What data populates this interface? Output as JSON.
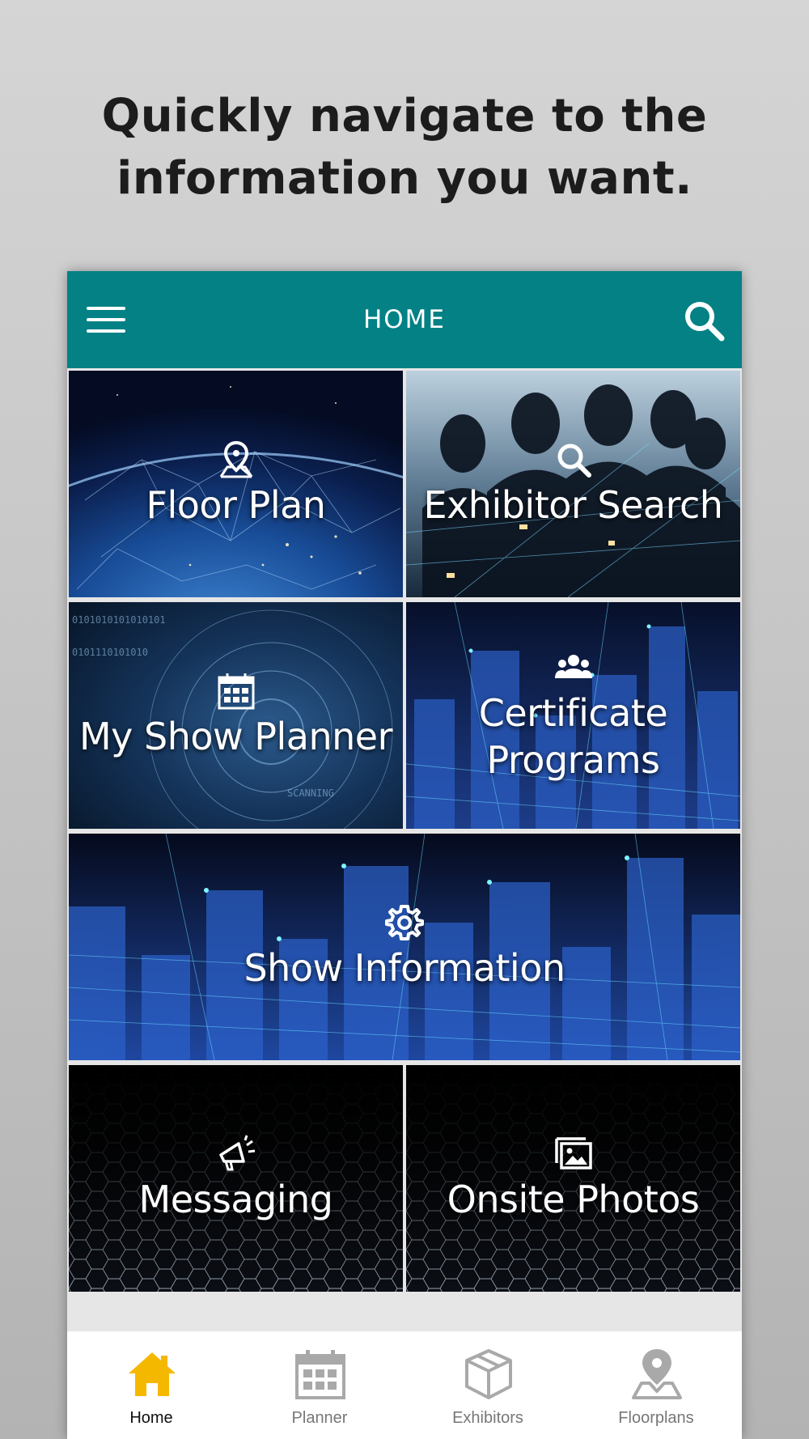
{
  "headline": {
    "line1": "Quickly navigate to the",
    "line2": "information you want."
  },
  "app_bar": {
    "title": "HOME",
    "menu_icon": "hamburger-menu-icon",
    "search_icon": "search-icon",
    "color": "#038185"
  },
  "tiles": [
    {
      "label": "Floor Plan",
      "icon": "map-pin-icon"
    },
    {
      "label": "Exhibitor Search",
      "icon": "search-icon"
    },
    {
      "label": "My Show Planner",
      "icon": "calendar-icon"
    },
    {
      "label_line1": "Certificate",
      "label_line2": "Programs",
      "icon": "group-icon"
    },
    {
      "label": "Show Information",
      "icon": "gear-icon"
    },
    {
      "label": "Messaging",
      "icon": "megaphone-icon"
    },
    {
      "label": "Onsite Photos",
      "icon": "photos-icon"
    }
  ],
  "tab_bar": {
    "items": [
      {
        "label": "Home",
        "icon": "home-icon",
        "active": true
      },
      {
        "label": "Planner",
        "icon": "calendar-icon",
        "active": false
      },
      {
        "label": "Exhibitors",
        "icon": "box-icon",
        "active": false
      },
      {
        "label": "Floorplans",
        "icon": "map-pin-icon",
        "active": false
      }
    ],
    "active_color": "#f5b800",
    "inactive_color": "#a9a9a9"
  }
}
